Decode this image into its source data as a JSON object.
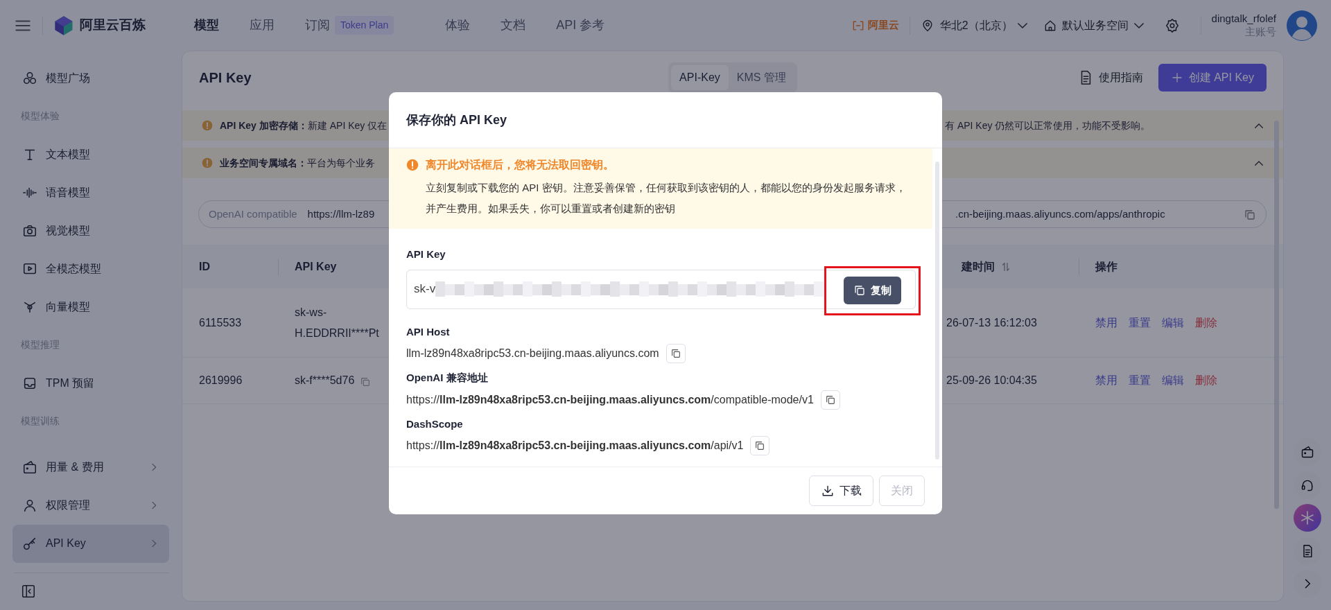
{
  "topbar": {
    "brand": "阿里云百炼",
    "nav": [
      {
        "label": "模型",
        "selected": true
      },
      {
        "label": "应用",
        "selected": false
      },
      {
        "label": "订阅",
        "selected": false,
        "badge": "Token Plan"
      },
      {
        "label": "体验",
        "selected": false
      },
      {
        "label": "文档",
        "selected": false
      },
      {
        "label": "API 参考",
        "selected": false
      }
    ],
    "cloud_logo": "阿里云",
    "region": "华北2（北京）",
    "workspace": "默认业务空间",
    "user": {
      "name": "dingtalk_rfolef",
      "role": "主账号"
    }
  },
  "sidebar": {
    "items": [
      {
        "kind": "item",
        "label": "模型广场",
        "selected": false,
        "expandable": false
      },
      {
        "kind": "section",
        "label": "模型体验"
      },
      {
        "kind": "item",
        "label": "文本模型",
        "selected": false,
        "expandable": false
      },
      {
        "kind": "item",
        "label": "语音模型",
        "selected": false,
        "expandable": false
      },
      {
        "kind": "item",
        "label": "视觉模型",
        "selected": false,
        "expandable": false
      },
      {
        "kind": "item",
        "label": "全模态模型",
        "selected": false,
        "expandable": false
      },
      {
        "kind": "item",
        "label": "向量模型",
        "selected": false,
        "expandable": false
      },
      {
        "kind": "section",
        "label": "模型推理"
      },
      {
        "kind": "item",
        "label": "TPM 预留",
        "selected": false,
        "expandable": false
      },
      {
        "kind": "section",
        "label": "模型训练"
      }
    ],
    "bottom_items": [
      {
        "label": "用量 & 费用",
        "selected": false,
        "expandable": true
      },
      {
        "label": "权限管理",
        "selected": false,
        "expandable": true
      },
      {
        "label": "API Key",
        "selected": true,
        "expandable": true
      }
    ]
  },
  "page": {
    "title": "API Key",
    "tabs": [
      {
        "label": "API-Key",
        "selected": true
      },
      {
        "label": "KMS 管理",
        "selected": false
      }
    ],
    "guide_link": "使用指南",
    "create_button": "创建 API Key",
    "notices": [
      {
        "text": "**API Key 加密存储：**新建 API Key 仅在",
        "text_right": "有 API Key 仍然可以正常使用，功能不受影响。",
        "expanded": true
      },
      {
        "text": "**业务空间专属域名：**平台为每个业务",
        "expanded": true
      }
    ],
    "endpoint": {
      "label": "OpenAI compatible",
      "url_start": "https://llm-lz89",
      "url_end": ".cn-beijing.maas.aliyuncs.com/apps/anthropic"
    },
    "table": {
      "columns": [
        {
          "label": "ID",
          "sortable": false
        },
        {
          "label": "API Key",
          "sortable": false
        },
        {
          "label": "建时间",
          "sortable": true
        },
        {
          "label": "操作",
          "sortable": false
        }
      ],
      "rows": [
        {
          "id": "6115533",
          "api_key": "sk-ws-H.EDDRRII****Pt",
          "copyable": false,
          "created": "26-07-13 16:12:03",
          "actions": [
            {
              "label": "禁用",
              "kind": "link"
            },
            {
              "label": "重置",
              "kind": "link"
            },
            {
              "label": "编辑",
              "kind": "link"
            },
            {
              "label": "删除",
              "kind": "danger"
            }
          ]
        },
        {
          "id": "2619996",
          "api_key": "sk-f****5d76",
          "copyable": true,
          "created": "25-09-26 10:04:35",
          "actions": [
            {
              "label": "禁用",
              "kind": "link"
            },
            {
              "label": "重置",
              "kind": "link"
            },
            {
              "label": "编辑",
              "kind": "link"
            },
            {
              "label": "删除",
              "kind": "danger"
            }
          ]
        }
      ]
    }
  },
  "dialog": {
    "title": "保存你的 API Key",
    "warning": {
      "title": "离开此对话框后，您将无法取回密钥。",
      "text": "立刻复制或下载您的 API 密钥。注意妥善保管，任何获取到该密钥的人，都能以您的身份发起服务请求，并产生费用。如果丢失，你可以重置或者创建新的密钥"
    },
    "key_field": {
      "label": "API Key",
      "value": "sk-v",
      "copy_button": "复制",
      "highlighted": true
    },
    "fields": [
      {
        "label": "API Host",
        "value": "llm-lz89n48xa8ripc53.cn-beijing.maas.aliyuncs.com"
      },
      {
        "label": "OpenAI 兼容地址",
        "value": "https://**llm-lz89n48xa8ripc53.cn-beijing.maas.aliyuncs.com**/compatible-mode/v1"
      },
      {
        "label": "DashScope",
        "value": "https://**llm-lz89n48xa8ripc53.cn-beijing.maas.aliyuncs.com**/api/v1"
      }
    ],
    "buttons": [
      {
        "label": "下载",
        "disabled": false
      },
      {
        "label": "关闭",
        "disabled": true
      }
    ]
  }
}
